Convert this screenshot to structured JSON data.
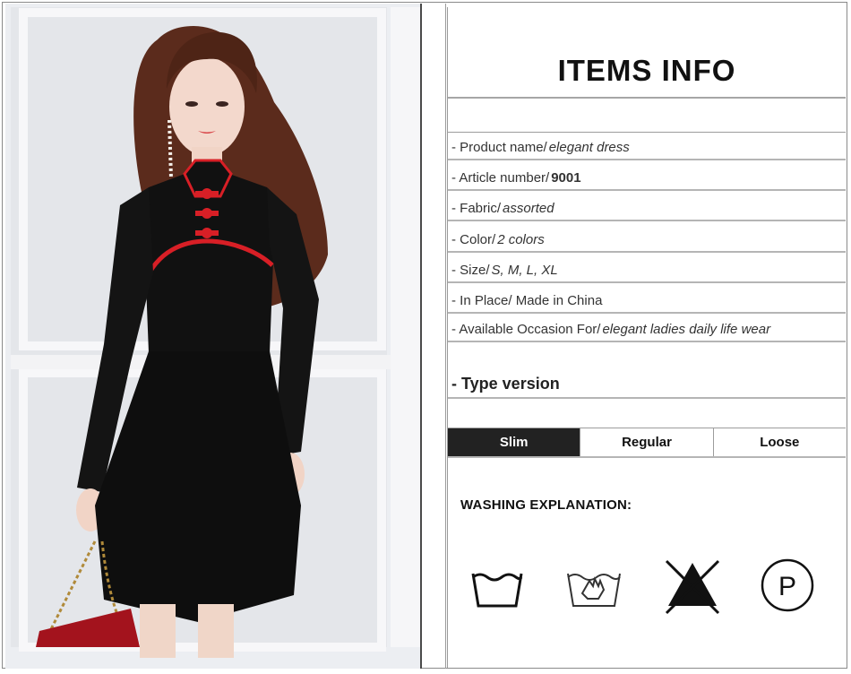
{
  "info": {
    "title": "ITEMS INFO",
    "rows": [
      {
        "label": "- Product name/ ",
        "value": "elegant dress",
        "bold": false
      },
      {
        "label": "- Article number/ ",
        "value": "9001",
        "bold": true
      },
      {
        "label": "- Fabric/ ",
        "value": "assorted",
        "bold": false
      },
      {
        "label": "- Color/ ",
        "value": "2 colors",
        "bold": false
      },
      {
        "label": "- Size/ ",
        "value": "S, M, L, XL",
        "bold": false
      },
      {
        "label": "- In Place/ Made in China",
        "value": "",
        "bold": false
      },
      {
        "label": "- Available Occasion For/ ",
        "value": "elegant ladies daily life wear",
        "bold": false
      }
    ],
    "type_version": "- Type version",
    "fits": [
      {
        "label": "Slim",
        "active": true
      },
      {
        "label": "Regular",
        "active": false
      },
      {
        "label": "Loose",
        "active": false
      }
    ],
    "washing_title": "WASHING EXPLANATION:",
    "washing_icons": [
      "machine-wash-icon",
      "hand-wash-icon",
      "do-not-bleach-icon",
      "dry-clean-p-icon"
    ],
    "dry_clean_letter": "P"
  },
  "colors": {
    "dress": "#111111",
    "trim": "#d81f26",
    "bag": "#a3131d",
    "hair": "#5a2a1a",
    "wall": "#e7e9ee",
    "fit_active_bg": "#222222"
  }
}
